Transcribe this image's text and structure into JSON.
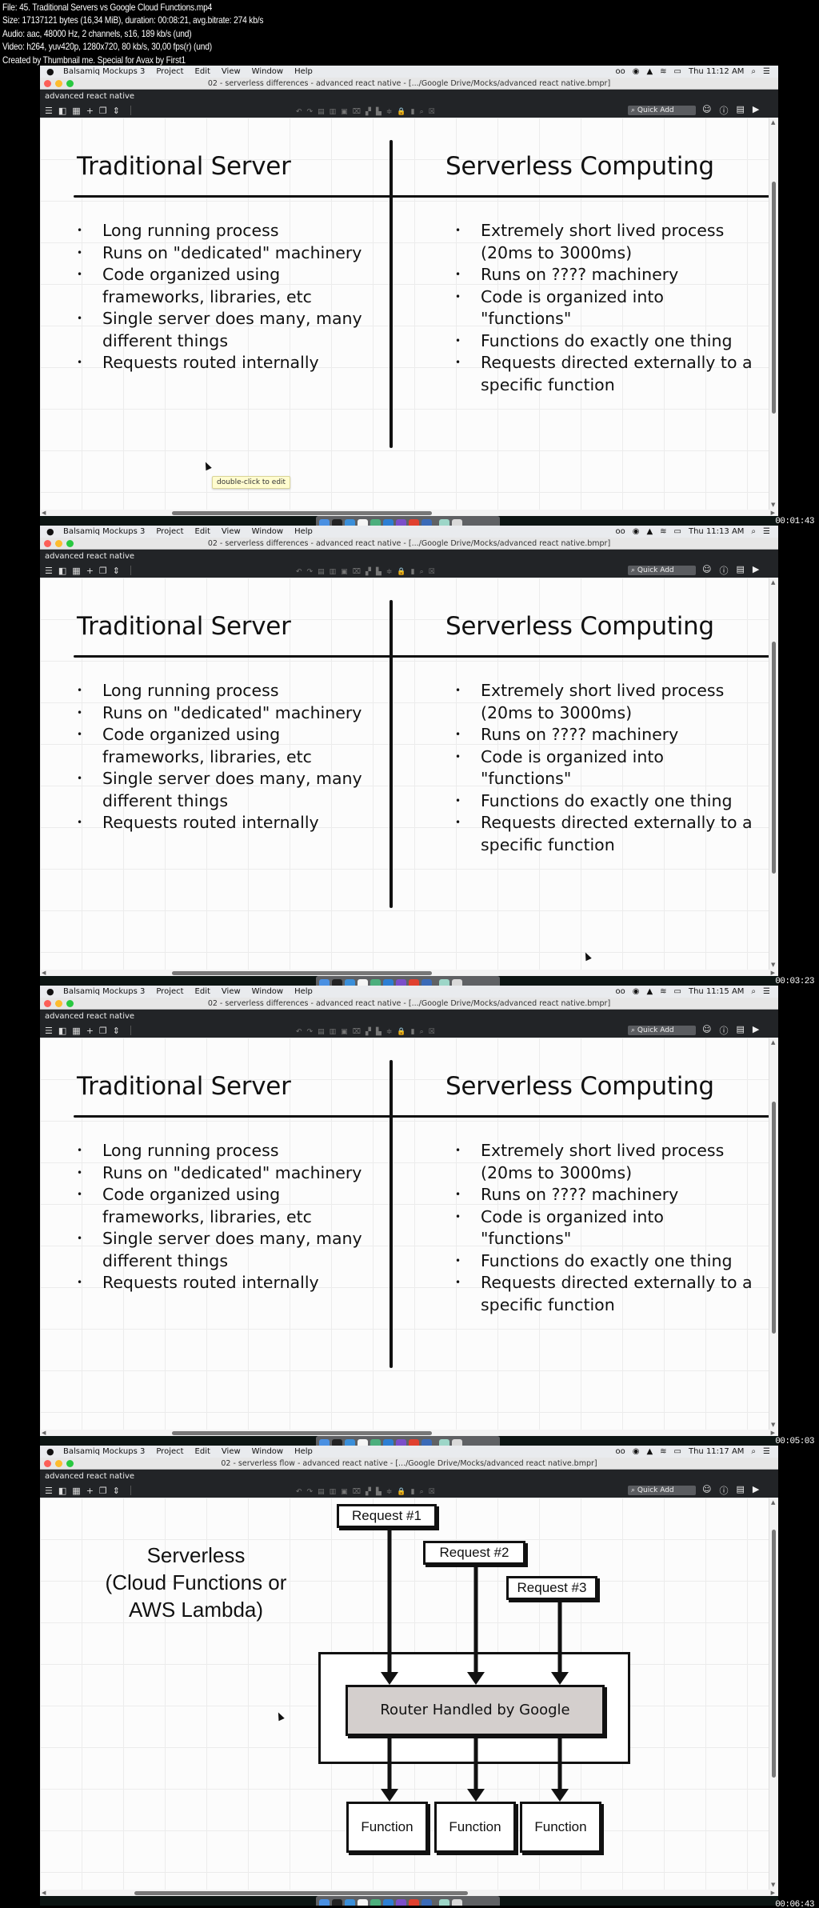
{
  "file_info": [
    "File: 45. Traditional Servers vs Google Cloud Functions.mp4",
    "Size: 17137121 bytes (16,34 MiB), duration: 00:08:21, avg.bitrate: 274 kb/s",
    "Audio: aac, 48000 Hz, 2 channels, s16, 189 kb/s (und)",
    "Video: h264, yuv420p, 1280x720, 80 kb/s, 30,00 fps(r) (und)",
    "Created by Thumbnail me. Special for Avax by First1"
  ],
  "app": {
    "apple_icon": "",
    "menu": [
      "Balsamiq Mockups 3",
      "Project",
      "Edit",
      "View",
      "Window",
      "Help"
    ],
    "status_icons": [
      "glasses-icon",
      "record-icon",
      "drive-icon",
      "wifi-icon",
      "battery-icon"
    ],
    "status_glyphs": [
      "oo",
      "◉",
      "▲",
      "≋",
      "▭"
    ],
    "project_name": "advanced react native",
    "quick_add_placeholder": "⌕ Quick Add",
    "toolbar_left": [
      "☰",
      "◧",
      "▦",
      "+",
      "❐",
      "⇕"
    ],
    "toolbar_mid": [
      "↶",
      "↷",
      "▤",
      "▥",
      "▣",
      "⌧",
      "▞",
      "▙",
      "≑",
      "🔒",
      "▮",
      "⌕",
      "☒"
    ],
    "toolbar_right": [
      "☺",
      "ⓘ",
      "▤",
      "▶"
    ]
  },
  "frames": [
    {
      "timestamp": "00:01:43",
      "clock": "Thu 11:12 AM",
      "window_title": "02 - serverless differences - advanced react native - [.../Google Drive/Mocks/advanced react native.bmpr]",
      "tooltip": "double-click to edit"
    },
    {
      "timestamp": "00:03:23",
      "clock": "Thu 11:13 AM",
      "window_title": "02 - serverless differences - advanced react native - [.../Google Drive/Mocks/advanced react native.bmpr]"
    },
    {
      "timestamp": "00:05:03",
      "clock": "Thu 11:15 AM",
      "window_title": "02 - serverless differences - advanced react native - [.../Google Drive/Mocks/advanced react native.bmpr]"
    },
    {
      "timestamp": "00:06:43",
      "clock": "Thu 11:17 AM",
      "window_title": "02 - serverless flow - advanced react native - [.../Google Drive/Mocks/advanced react native.bmpr]"
    }
  ],
  "comparison": {
    "left_title": "Traditional Server",
    "right_title": "Serverless Computing",
    "left_items": [
      "Long running process",
      "Runs on \"dedicated\" machinery",
      "Code organized using frameworks, libraries, etc",
      "Single server does many, many different things",
      "Requests routed internally"
    ],
    "right_items": [
      "Extremely short lived process (20ms to 3000ms)",
      "Runs on ???? machinery",
      "Code is organized into \"functions\"",
      "Functions do exactly one thing",
      "Requests directed externally to a specific function"
    ]
  },
  "flow": {
    "title_lines": [
      "Serverless",
      "(Cloud Functions or",
      "AWS Lambda)"
    ],
    "requests": [
      "Request #1",
      "Request #2",
      "Request #3"
    ],
    "router": "Router Handled by Google",
    "functions": [
      "Function",
      "Function",
      "Function"
    ]
  },
  "dock_colors": [
    "#4a90e2",
    "#222",
    "#3b8fd9",
    "#f5f5f5",
    "#4caf7d",
    "#2d7fd3",
    "#7b4fc9",
    "#e0402f",
    "#3a6ab8",
    "#9dd6c8",
    "#d9d9d9"
  ]
}
